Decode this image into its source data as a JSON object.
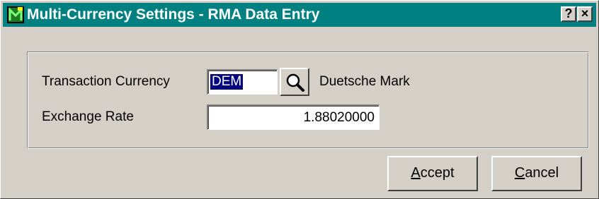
{
  "window": {
    "title": "Multi-Currency Settings - RMA Data Entry",
    "help_label": "?",
    "close_label": "×",
    "title_bg": "#008080"
  },
  "form": {
    "transaction_currency_label": "Transaction Currency",
    "currency_code": "DEM",
    "currency_name": "Duetsche Mark",
    "exchange_rate_label": "Exchange Rate",
    "exchange_rate": "1.88020000",
    "lookup_icon": "magnifier-icon"
  },
  "buttons": {
    "accept_hotkey": "A",
    "accept_rest": "ccept",
    "cancel_hotkey": "C",
    "cancel_rest": "ancel"
  }
}
